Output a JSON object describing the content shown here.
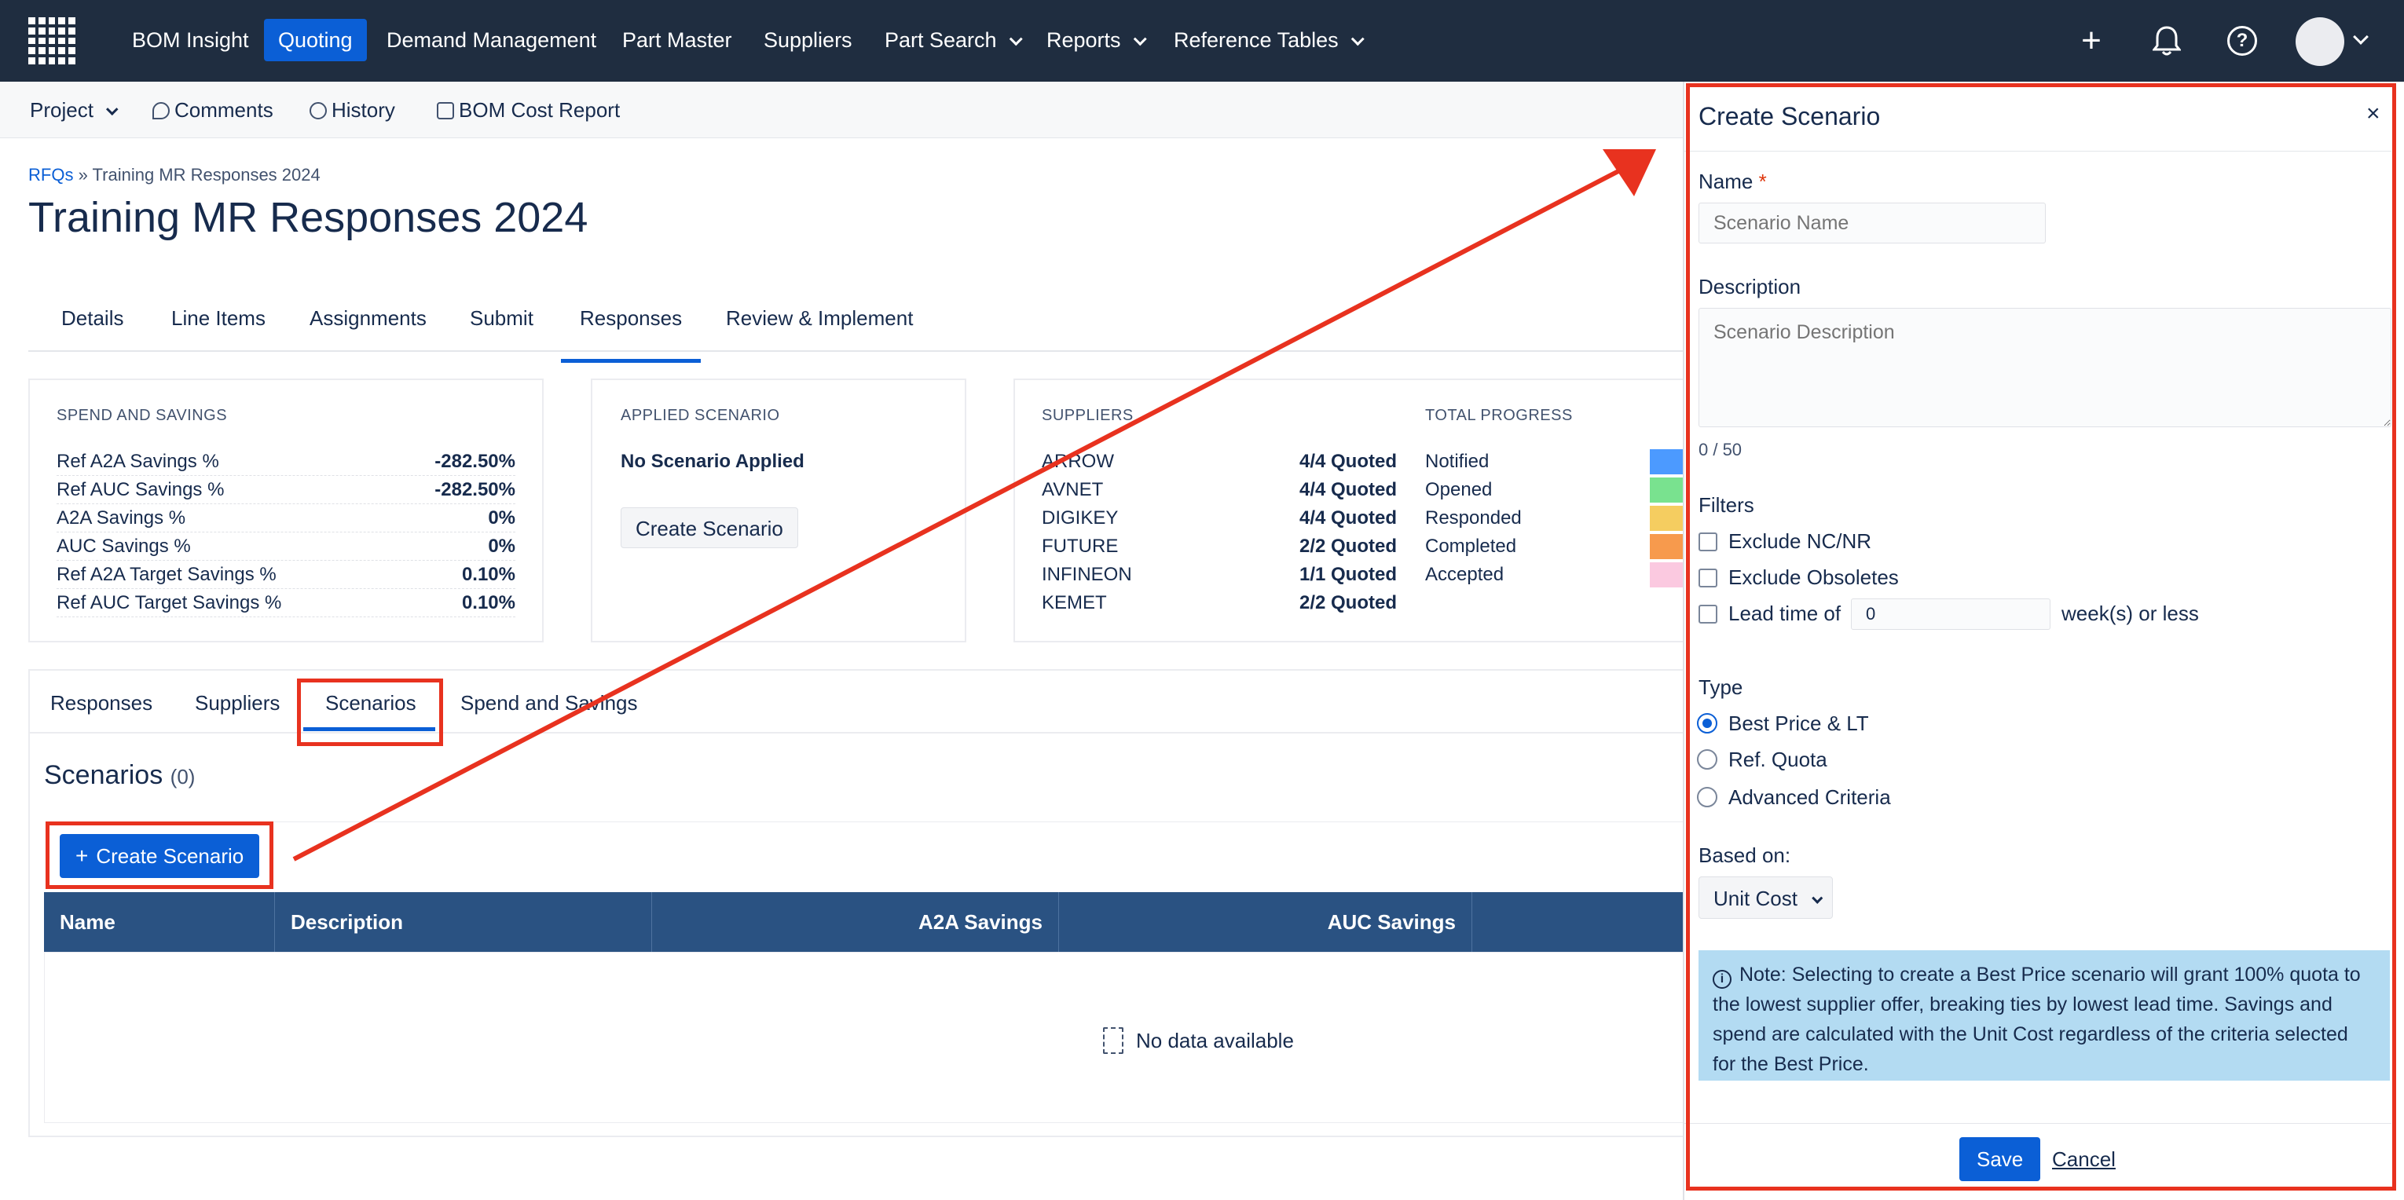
{
  "nav": {
    "items": [
      {
        "label": "BOM Insight"
      },
      {
        "label": "Quoting"
      },
      {
        "label": "Demand Management"
      },
      {
        "label": "Part Master"
      },
      {
        "label": "Suppliers"
      },
      {
        "label": "Part Search"
      },
      {
        "label": "Reports"
      },
      {
        "label": "Reference Tables"
      }
    ],
    "plus": "+",
    "help": "?"
  },
  "subbar": {
    "project": "Project",
    "comments": "Comments",
    "history": "History",
    "bom_cost_report": "BOM Cost Report"
  },
  "breadcrumb": {
    "root": "RFQs",
    "sep": " » ",
    "current": "Training MR Responses 2024"
  },
  "page_title": "Training MR Responses 2024",
  "main_tabs": [
    "Details",
    "Line Items",
    "Assignments",
    "Submit",
    "Responses",
    "Review & Implement"
  ],
  "spend": {
    "heading": "SPEND AND SAVINGS",
    "rows": [
      {
        "label": "Ref A2A Savings %",
        "value": "-282.50%"
      },
      {
        "label": "Ref AUC Savings %",
        "value": "-282.50%"
      },
      {
        "label": "A2A Savings %",
        "value": "0%"
      },
      {
        "label": "AUC Savings %",
        "value": "0%"
      },
      {
        "label": "Ref A2A Target Savings %",
        "value": "0.10%"
      },
      {
        "label": "Ref AUC Target Savings %",
        "value": "0.10%"
      }
    ]
  },
  "applied": {
    "heading": "APPLIED SCENARIO",
    "value": "No Scenario Applied",
    "button": "Create Scenario"
  },
  "suppliers": {
    "heading": "SUPPLIERS",
    "rows": [
      {
        "name": "ARROW",
        "status": "4/4 Quoted"
      },
      {
        "name": "AVNET",
        "status": "4/4 Quoted"
      },
      {
        "name": "DIGIKEY",
        "status": "4/4 Quoted"
      },
      {
        "name": "FUTURE",
        "status": "2/2 Quoted"
      },
      {
        "name": "INFINEON",
        "status": "1/1 Quoted"
      },
      {
        "name": "KEMET",
        "status": "2/2 Quoted"
      }
    ]
  },
  "progress": {
    "heading": "TOTAL PROGRESS",
    "rows": [
      {
        "label": "Notified",
        "color": "#4c9aff"
      },
      {
        "label": "Opened",
        "color": "#79e28f"
      },
      {
        "label": "Responded",
        "color": "#f5cd60"
      },
      {
        "label": "Completed",
        "color": "#f79a4d"
      },
      {
        "label": "Accepted",
        "color": "#fbc9e0"
      }
    ]
  },
  "inner_tabs": [
    "Responses",
    "Suppliers",
    "Scenarios",
    "Spend and Savings"
  ],
  "scenarios": {
    "title": "Scenarios",
    "count": "(0)",
    "create_button": "Create Scenario",
    "columns": [
      "Name",
      "Description",
      "A2A Savings",
      "AUC Savings"
    ],
    "empty": "No data available"
  },
  "drawer": {
    "title": "Create Scenario",
    "close": "×",
    "name_label": "Name",
    "required_mark": "*",
    "name_placeholder": "Scenario Name",
    "desc_label": "Description",
    "desc_placeholder": "Scenario Description",
    "counter": "0 / 50",
    "filters_label": "Filters",
    "exclude_ncnr": "Exclude NC/NR",
    "exclude_obsoletes": "Exclude Obsoletes",
    "lead_time_label": "Lead time of",
    "lead_time_value": "0",
    "lead_time_suffix": "week(s) or less",
    "type_label": "Type",
    "types": [
      "Best Price & LT",
      "Ref. Quota",
      "Advanced Criteria"
    ],
    "selected_type": "Best Price & LT",
    "based_on_label": "Based on:",
    "based_on_value": "Unit Cost",
    "note": "Note: Selecting to create a Best Price scenario will grant 100% quota to the lowest supplier offer, breaking ties by lowest lead time. Savings and spend are calculated with the Unit Cost regardless of the criteria selected for the Best Price.",
    "save": "Save",
    "cancel": "Cancel"
  },
  "icons": {
    "logo": "grid-logo-icon",
    "plus": "plus-icon",
    "bell": "bell-icon",
    "help": "help-icon",
    "comments": "comment-icon",
    "history": "history-icon",
    "report": "document-icon",
    "info": "info-icon",
    "empty": "empty-document-icon"
  },
  "colors": {
    "nav_bg": "#1f2d40",
    "accent": "#0b5fd6",
    "table_header": "#2a5282",
    "annotation": "#e8321f",
    "note_bg": "#b3dbf2"
  }
}
